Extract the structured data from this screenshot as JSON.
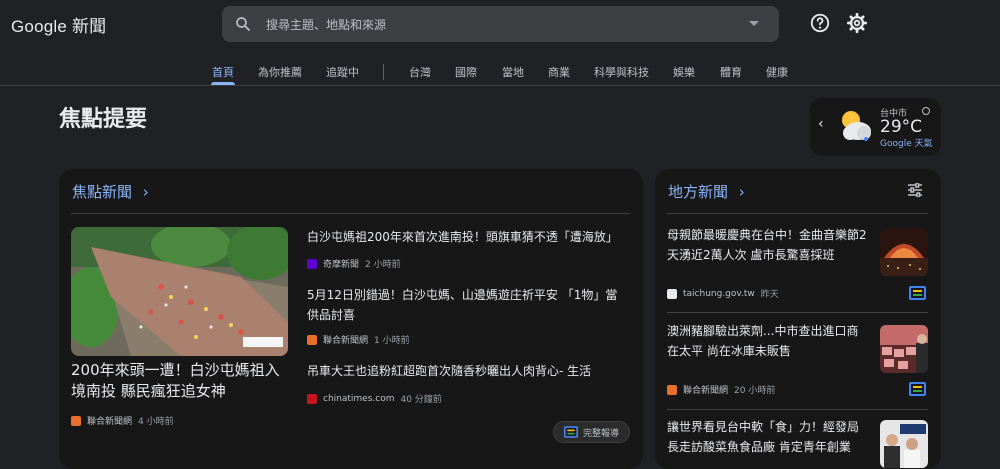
{
  "header": {
    "logo": "Google 新聞",
    "search_placeholder": "搜尋主題、地點和來源"
  },
  "nav": {
    "tabs": [
      "首頁",
      "為你推薦",
      "追蹤中",
      "台灣",
      "國際",
      "當地",
      "商業",
      "科學與科技",
      "娛樂",
      "體育",
      "健康"
    ],
    "active": "首頁"
  },
  "page": {
    "headline": "焦點提要"
  },
  "weather": {
    "city": "台中市",
    "temp": "29°C",
    "source": "Google 天氣"
  },
  "top_stories": {
    "title": "焦點新聞",
    "featured": {
      "title": "200年來頭一遭！白沙屯媽祖入境南投 縣民瘋狂追女神",
      "source": "聯合新聞網",
      "time": "4 小時前"
    },
    "articles": [
      {
        "title": "白沙屯媽祖200年來首次進南投！頭旗車猜不透「遭海放」",
        "source": "奇摩新聞",
        "time": "2 小時前"
      },
      {
        "title": "5月12日別錯過！白沙屯媽、山邊媽遊庄祈平安 「1物」當供品討喜",
        "source": "聯合新聞網",
        "time": "1 小時前"
      },
      {
        "title": "吊車大王也追粉紅超跑首次隨香秒曬出人肉背心- 生活",
        "source": "chinatimes.com",
        "time": "40 分鐘前"
      }
    ],
    "full_coverage": "完整報導"
  },
  "local_news": {
    "title": "地方新聞",
    "items": [
      {
        "title": "母親節最暖慶典在台中！金曲音樂節2天湧近2萬人次 盧市長驚喜採班",
        "source": "taichung.gov.tw",
        "time": "昨天"
      },
      {
        "title": "澳洲豬腳驗出萊劑...中市查出進口商在太平 尚在冰庫未販售",
        "source": "聯合新聞網",
        "time": "20 小時前"
      },
      {
        "title": "讓世界看見台中軟「食」力！經發局長走訪酸菜魚食品廠 肯定青年創業",
        "source": "",
        "time": ""
      }
    ]
  },
  "colors": {
    "background": "#202124",
    "card": "#171717",
    "accent": "#8ab4f8",
    "text": "#e8eaed",
    "muted": "#9aa0a6"
  }
}
